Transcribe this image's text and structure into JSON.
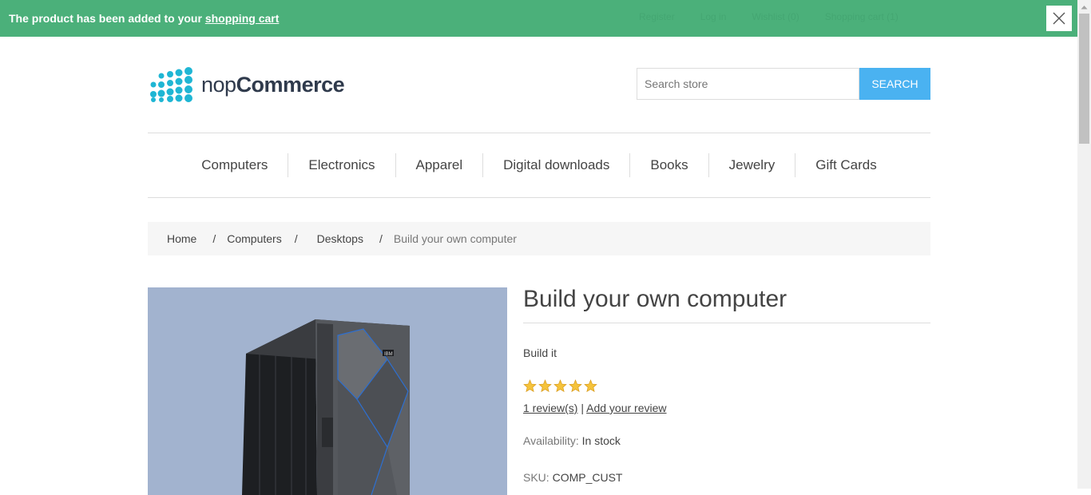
{
  "notification": {
    "text": "The product has been added to your ",
    "link": "shopping cart"
  },
  "header_links": [
    "Register",
    "Log in",
    "Wishlist (0)",
    "Shopping cart (1)"
  ],
  "logo": {
    "light": "nop",
    "bold": "Commerce"
  },
  "search": {
    "placeholder": "Search store",
    "button": "SEARCH"
  },
  "menu": [
    "Computers",
    "Electronics",
    "Apparel",
    "Digital downloads",
    "Books",
    "Jewelry",
    "Gift Cards"
  ],
  "breadcrumb": {
    "home": "Home",
    "sep": "/",
    "computers": "Computers",
    "desktops": "Desktops",
    "current": "Build your own computer"
  },
  "product": {
    "title": "Build your own computer",
    "short_description": "Build it",
    "rating_stars": 5,
    "reviews_link": "1 review(s)",
    "review_sep": "|",
    "add_review": "Add your review",
    "availability_label": "Availability:",
    "availability_value": "In stock",
    "sku_label": "SKU:",
    "sku_value": "COMP_CUST"
  },
  "colors": {
    "notification_bg": "#4bb07a",
    "search_button": "#4ab2f1",
    "image_bg": "#a2b3cf",
    "star": "#f5c33b"
  }
}
